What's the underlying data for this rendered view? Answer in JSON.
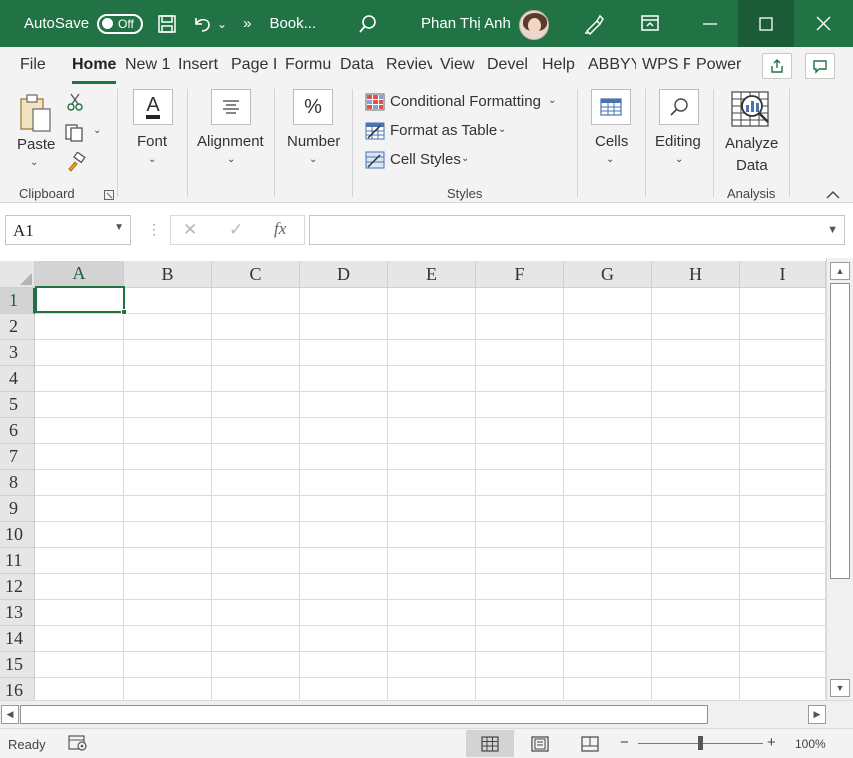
{
  "titlebar": {
    "autosave_label": "AutoSave",
    "autosave_state": "Off",
    "doc_name": "Book...",
    "user_name": "Phan Thị Anh",
    "more": "»",
    "undo_dropdown": "⌄",
    "accent_color": "#217346"
  },
  "menu": {
    "tabs": [
      "File",
      "Home",
      "New 1",
      "Insert",
      "Page I",
      "Formu",
      "Data",
      "Reviev",
      "View",
      "Devel",
      "Help",
      "ABBYY",
      "WPS F",
      "Power"
    ],
    "active_tab": "Home"
  },
  "ribbon": {
    "clipboard": {
      "paste": "Paste",
      "label": "Clipboard"
    },
    "font": {
      "label": "Font",
      "icon_letter": "A"
    },
    "alignment": {
      "label": "Alignment"
    },
    "number": {
      "label": "Number",
      "icon_symbol": "%"
    },
    "styles": {
      "conditional_formatting": "Conditional Formatting",
      "format_as_table": "Format as Table",
      "cell_styles": "Cell Styles",
      "label": "Styles"
    },
    "cells": {
      "label": "Cells"
    },
    "editing": {
      "label": "Editing"
    },
    "analysis": {
      "analyze_line1": "Analyze",
      "analyze_line2": "Data",
      "label": "Analysis"
    }
  },
  "formula_bar": {
    "name_box": "A1",
    "fx": "fx",
    "cancel": "✕",
    "enter": "✓",
    "value": ""
  },
  "grid": {
    "columns": [
      "A",
      "B",
      "C",
      "D",
      "E",
      "F",
      "G",
      "H",
      "I"
    ],
    "rows": [
      "1",
      "2",
      "3",
      "4",
      "5",
      "6",
      "7",
      "8",
      "9",
      "10",
      "11",
      "12",
      "13",
      "14",
      "15",
      "16"
    ],
    "selected_cell": "A1"
  },
  "statusbar": {
    "ready": "Ready",
    "zoom_out": "−",
    "zoom_in": "+",
    "zoom": "100%",
    "zoom_level": 1.0
  }
}
